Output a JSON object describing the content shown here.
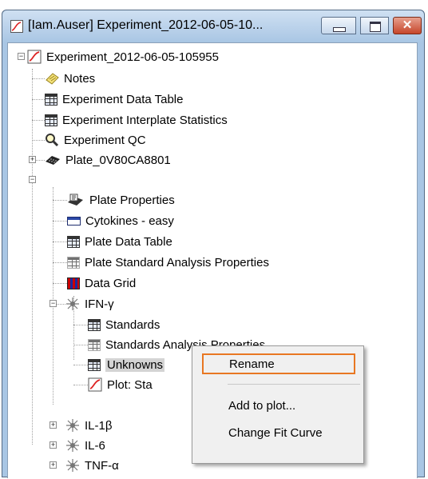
{
  "window": {
    "title": "[Iam.Auser] Experiment_2012-06-05-10...",
    "close_glyph": "✕"
  },
  "tree": {
    "root": "Experiment_2012-06-05-105955",
    "items": [
      {
        "label": "Notes",
        "icon": "notes-icon"
      },
      {
        "label": "Experiment Data Table",
        "icon": "table-icon"
      },
      {
        "label": "Experiment Interplate Statistics",
        "icon": "table-icon"
      },
      {
        "label": "Experiment QC",
        "icon": "magnifier-icon"
      },
      {
        "label": "Plate_0V80CA8801",
        "icon": "plate-icon"
      },
      {
        "label": "Plate Properties",
        "icon": "plate-properties-icon"
      },
      {
        "label": "Cytokines - easy",
        "icon": "panel-icon"
      },
      {
        "label": "Plate Data Table",
        "icon": "table-icon"
      },
      {
        "label": "Plate Standard Analysis Properties",
        "icon": "grey-table-icon"
      },
      {
        "label": "Data Grid",
        "icon": "heatmap-icon"
      },
      {
        "label": "IFN-γ",
        "icon": "analyte-icon"
      },
      {
        "label": "Standards",
        "icon": "table-icon"
      },
      {
        "label": "Standards Analysis Properties",
        "icon": "grey-table-icon"
      },
      {
        "label": "Unknowns",
        "icon": "table-icon"
      },
      {
        "label": "Plot: Sta",
        "icon": "plot-icon"
      },
      {
        "label": "IL-1β",
        "icon": "analyte-icon"
      },
      {
        "label": "IL-6",
        "icon": "analyte-icon"
      },
      {
        "label": "TNF-α",
        "icon": "analyte-icon"
      }
    ]
  },
  "context_menu": {
    "rename": "Rename",
    "add_to_plot": "Add to plot...",
    "change_fit_curve": "Change Fit Curve"
  },
  "colors": {
    "title_bar": "#a9c6e4",
    "highlight_box": "#e87722",
    "selection": "#d4d4d4"
  }
}
